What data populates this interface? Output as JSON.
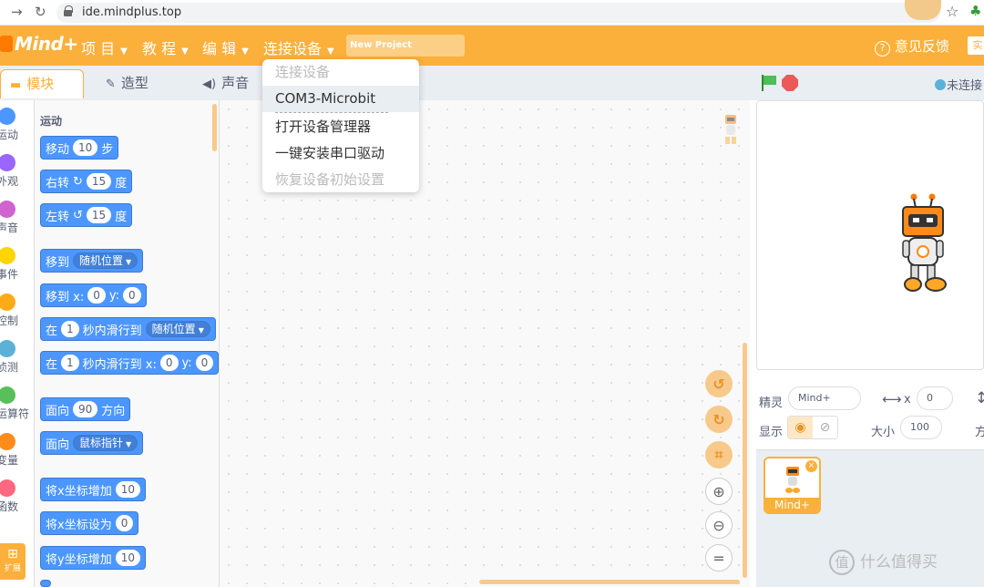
{
  "browser": {
    "url": "ide.mindplus.top"
  },
  "menubar": {
    "logo": "Mind+",
    "items": [
      {
        "label": "项 目"
      },
      {
        "label": "教 程"
      },
      {
        "label": "编 辑"
      },
      {
        "label": "连接设备"
      }
    ],
    "project_name": "New Project",
    "feedback": "意见反馈",
    "lab_button": "实"
  },
  "tabs": [
    {
      "label": "模块",
      "icon": "blocks-icon"
    },
    {
      "label": "造型",
      "icon": "brush-icon"
    },
    {
      "label": "声音",
      "icon": "speaker-icon"
    }
  ],
  "stage_header": {
    "status": "未连接"
  },
  "categories": [
    {
      "label": "运动",
      "color": "#4c97ff"
    },
    {
      "label": "外观",
      "color": "#9966ff"
    },
    {
      "label": "声音",
      "color": "#cf63cf"
    },
    {
      "label": "事件",
      "color": "#ffd500"
    },
    {
      "label": "控制",
      "color": "#ffab19"
    },
    {
      "label": "侦测",
      "color": "#5cb1d6"
    },
    {
      "label": "运算符",
      "color": "#59c059"
    },
    {
      "label": "变量",
      "color": "#ff8c1a"
    },
    {
      "label": "函数",
      "color": "#ff6680"
    }
  ],
  "extension_label": "扩展",
  "palette": {
    "section": "运动",
    "blocks": {
      "move": {
        "a": "移动",
        "v": "10",
        "b": "步"
      },
      "turn_right": {
        "a": "右转",
        "v": "15",
        "b": "度"
      },
      "turn_left": {
        "a": "左转",
        "v": "15",
        "b": "度"
      },
      "goto": {
        "a": "移到",
        "d": "随机位置"
      },
      "goto_xy": {
        "a": "移到 x:",
        "x": "0",
        "b": "y:",
        "y": "0"
      },
      "glide": {
        "a": "在",
        "v": "1",
        "b": "秒内滑行到",
        "d": "随机位置"
      },
      "glide_xy": {
        "a": "在",
        "v": "1",
        "b": "秒内滑行到 x:",
        "x": "0",
        "c": "y:",
        "y": "0"
      },
      "point_dir": {
        "a": "面向",
        "v": "90",
        "b": "方向"
      },
      "point_towards": {
        "a": "面向",
        "d": "鼠标指针"
      },
      "change_x": {
        "a": "将x坐标增加",
        "v": "10"
      },
      "set_x": {
        "a": "将x坐标设为",
        "v": "0"
      },
      "change_y": {
        "a": "将y坐标增加",
        "v": "10"
      }
    }
  },
  "dropdown": {
    "items": [
      {
        "label": "连接设备",
        "state": "disabled"
      },
      {
        "label": "COM3-Microbit",
        "state": "highlighted"
      },
      {
        "label": "打开设备管理器",
        "state": "normal"
      },
      {
        "label": "一键安装串口驱动",
        "state": "normal"
      },
      {
        "label": "恢复设备初始设置",
        "state": "disabled"
      }
    ]
  },
  "sprite_info": {
    "sprite_label": "精灵",
    "sprite_name": "Mind+",
    "x_label": "x",
    "x_value": "0",
    "show_label": "显示",
    "size_label": "大小",
    "size_value": "100",
    "direction_label_partial": "方"
  },
  "sprite_list": [
    {
      "name": "Mind+"
    }
  ],
  "watermark": {
    "symbol": "值",
    "text": "什么值得买"
  }
}
